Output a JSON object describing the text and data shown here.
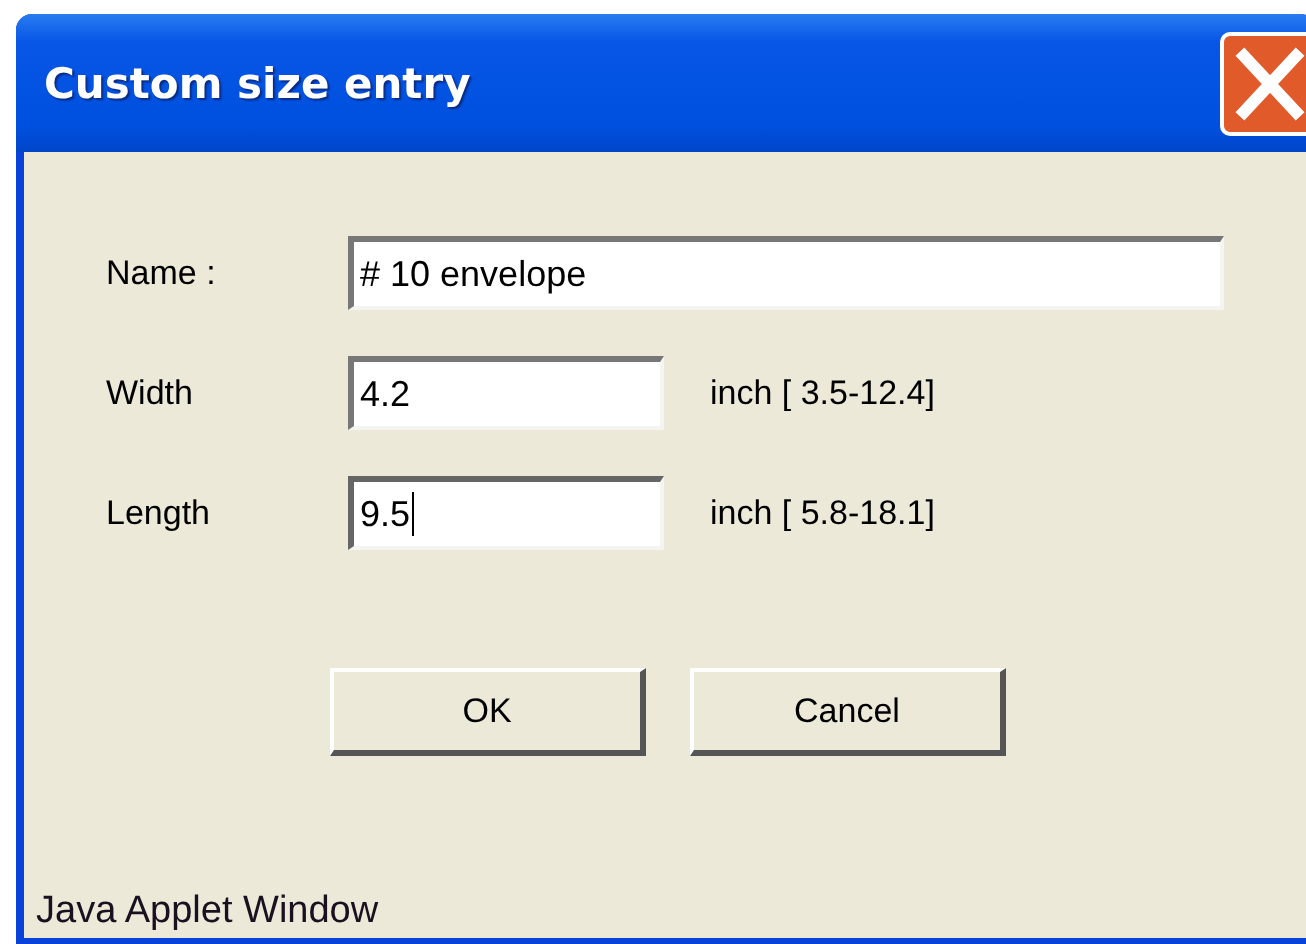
{
  "window": {
    "title": "Custom size entry"
  },
  "fields": [
    {
      "label": "Name :",
      "value": "# 10 envelope",
      "wide": true,
      "focused": false
    },
    {
      "label": "Width",
      "value": "4.2",
      "wide": false,
      "focused": false,
      "unit": "inch [ 3.5-12.4]"
    },
    {
      "label": "Length",
      "value": "9.5",
      "wide": false,
      "focused": true,
      "unit": "inch [ 5.8-18.1]"
    }
  ],
  "buttons": [
    "OK",
    "Cancel"
  ],
  "status_bar": "Java Applet Window"
}
